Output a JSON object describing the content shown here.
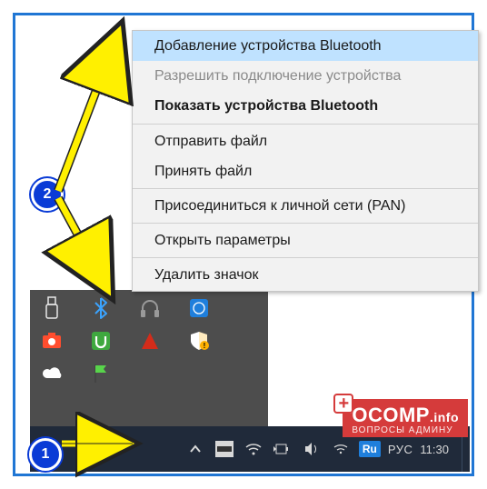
{
  "context_menu": {
    "items": [
      {
        "label": "Добавление устройства Bluetooth",
        "state": "highlight"
      },
      {
        "label": "Разрешить подключение устройства",
        "state": "disabled"
      },
      {
        "label": "Показать устройства Bluetooth",
        "state": "bold"
      },
      {
        "sep": true
      },
      {
        "label": "Отправить файл"
      },
      {
        "label": "Принять файл"
      },
      {
        "sep": true
      },
      {
        "label": "Присоединиться к личной сети (PAN)"
      },
      {
        "sep": true
      },
      {
        "label": "Открыть параметры"
      },
      {
        "sep": true
      },
      {
        "label": "Удалить значок"
      }
    ]
  },
  "tray": {
    "rows": [
      [
        {
          "icon": "usb-icon",
          "color": "#ffffff"
        },
        {
          "icon": "bluetooth-icon",
          "color": "#3aa3ff"
        },
        {
          "icon": "headphones-icon",
          "color": "#8f8f8f"
        },
        {
          "icon": "app-icon",
          "color": "#1f7fdc"
        }
      ],
      [
        {
          "icon": "camera-icon",
          "color": "#ff4d2e"
        },
        {
          "icon": "utorrent-icon",
          "color": "#3fa83f"
        },
        {
          "icon": "security-icon",
          "color": "#d42c1a"
        },
        {
          "icon": "shield-icon",
          "color": "#ffffff"
        }
      ],
      [
        {
          "icon": "cloud-icon",
          "color": "#ffffff"
        },
        {
          "icon": "flag-icon",
          "color": "#58d44b"
        }
      ]
    ]
  },
  "taskbar": {
    "chevron_label": "",
    "language_code": "Ru",
    "language": "РУС",
    "clock": "11:30"
  },
  "steps": {
    "s1": "1",
    "s2": "2"
  },
  "watermark": {
    "main": "OCOMP",
    "tld": ".info",
    "sub": "ВОПРОСЫ АДМИНУ"
  }
}
